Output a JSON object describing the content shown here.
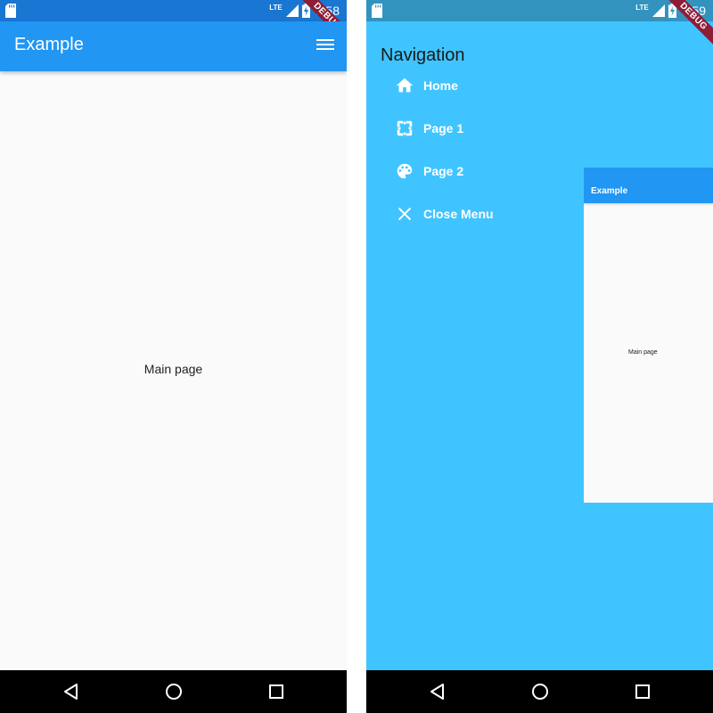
{
  "status_bar": {
    "network": "LTE"
  },
  "debug_banner": "DEBUG",
  "left_screen": {
    "status_time": "9:58",
    "app_title": "Example",
    "body_text": "Main page"
  },
  "right_screen": {
    "status_time": "9:59",
    "drawer_title": "Navigation",
    "menu_items": [
      {
        "label": "Home",
        "icon": "home-icon"
      },
      {
        "label": "Page 1",
        "icon": "page-icon"
      },
      {
        "label": "Page 2",
        "icon": "palette-icon"
      },
      {
        "label": "Close Menu",
        "icon": "close-icon"
      }
    ],
    "preview_title": "Example",
    "preview_text": "Main page"
  },
  "colors": {
    "app_bar": "#2196f3",
    "status_bar_left": "#1976d2",
    "status_bar_right": "#3293bf",
    "drawer_background": "#40c4ff",
    "debug_ribbon": "#8e1d38",
    "navigation_bar": "#000000"
  }
}
